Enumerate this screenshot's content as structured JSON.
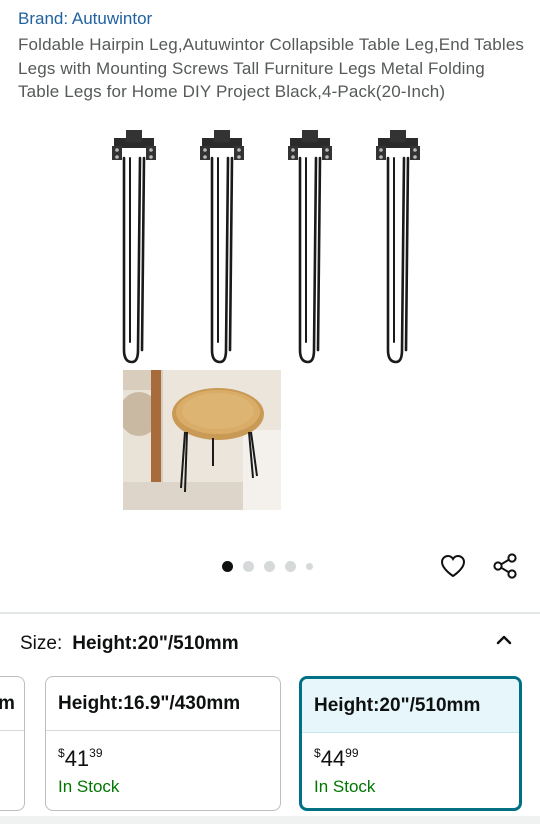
{
  "product": {
    "brand": "Brand: Autuwintor",
    "title": "Foldable Hairpin Leg,Autuwintor Collapsible Table Leg,End Tables Legs with Mounting Screws Tall Furniture Legs Metal Folding Table Legs for Home DIY Project Black,4-Pack(20-Inch)"
  },
  "gallery": {
    "main_image": "hairpin-legs-image",
    "secondary_image": "side-table-image",
    "dots_count": 5,
    "active_dot": 1
  },
  "actions": {
    "wishlist_icon": "heart-icon",
    "share_icon": "share-icon"
  },
  "size": {
    "label": "Size:",
    "value": "Height:20\"/510mm",
    "toggle_icon": "chevron-up-icon"
  },
  "swatches": [
    {
      "label": "m",
      "partial": true
    },
    {
      "label": "Height:16.9\"/430mm",
      "currency": "$",
      "whole": "41",
      "fraction": "39",
      "stock": "In Stock"
    },
    {
      "label": "Height:20\"/510mm",
      "currency": "$",
      "whole": "44",
      "fraction": "99",
      "stock": "In Stock",
      "selected": true
    }
  ],
  "colors": {
    "brand_link": "#2162a1",
    "in_stock": "#007600",
    "selected_border": "#007185"
  }
}
